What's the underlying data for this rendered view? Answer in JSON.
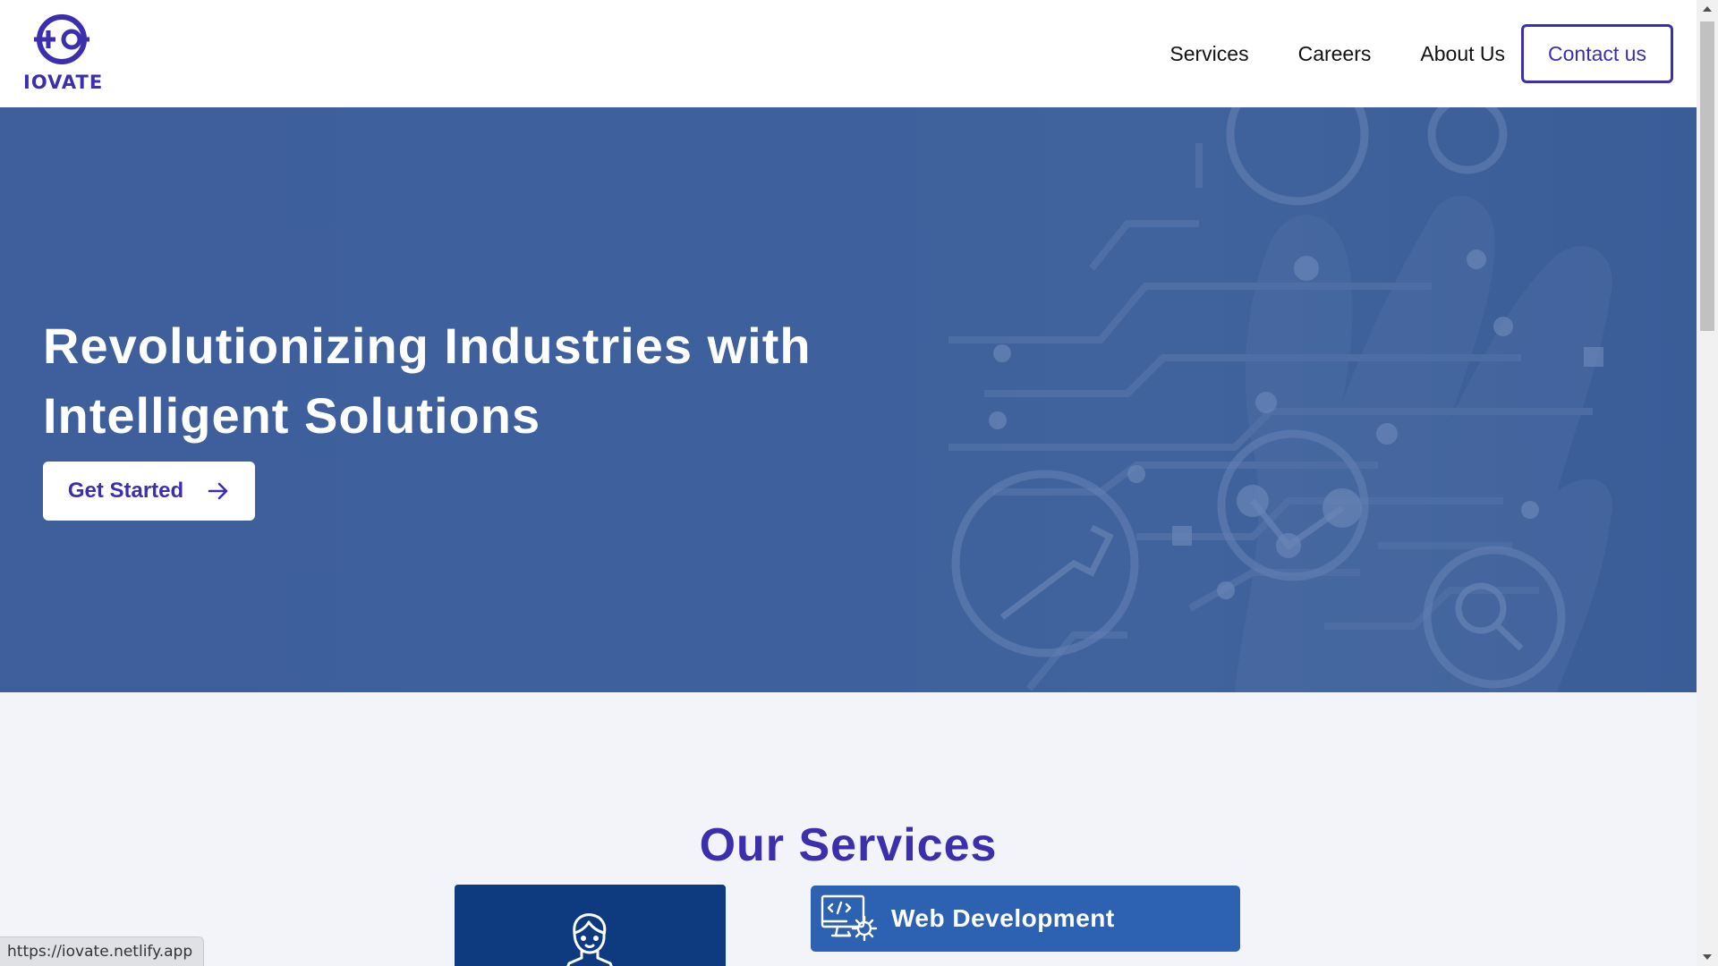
{
  "brand": {
    "name": "IOVATE",
    "color": "#3b2fae"
  },
  "nav": {
    "items": [
      {
        "label": "Services"
      },
      {
        "label": "Careers"
      },
      {
        "label": "About Us"
      }
    ],
    "contact_label": "Contact us"
  },
  "hero": {
    "title_line1": "Revolutionizing Industries with",
    "title_line2": "Intelligent Solutions",
    "cta_label": "Get Started",
    "cta_icon": "arrow-right-icon",
    "background_color": "#3e609c"
  },
  "services": {
    "title": "Our Services",
    "cards": [
      {
        "label": "",
        "icon": "person-icon",
        "color": "#0e3a80"
      },
      {
        "label": "Web Development",
        "icon": "web-development-icon",
        "color": "#2d62b3"
      }
    ]
  },
  "status_bar": {
    "url": "https://iovate.netlify.app"
  }
}
